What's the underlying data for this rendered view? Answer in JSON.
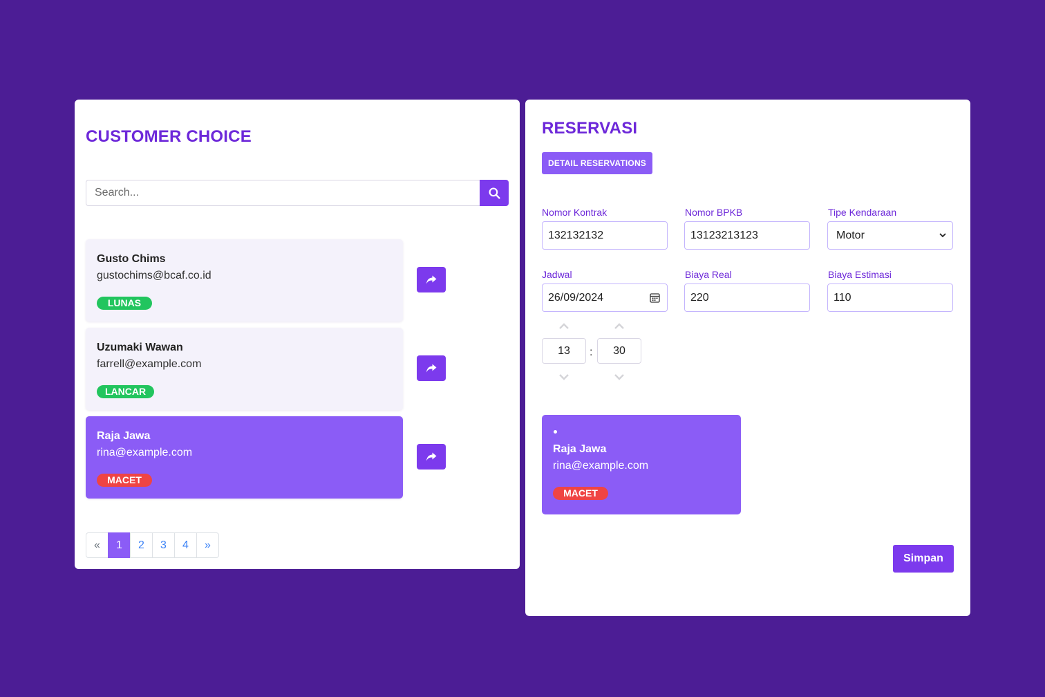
{
  "customer_panel": {
    "title": "CUSTOMER CHOICE",
    "search": {
      "placeholder": "Search...",
      "value": ""
    },
    "customers": [
      {
        "name": "Gusto Chims",
        "email": "gustochims@bcaf.co.id",
        "status": "LUNAS",
        "status_color": "#22c55e",
        "selected": false
      },
      {
        "name": "Uzumaki Wawan",
        "email": "farrell@example.com",
        "status": "LANCAR",
        "status_color": "#22c55e",
        "selected": false
      },
      {
        "name": "Raja Jawa",
        "email": "rina@example.com",
        "status": "MACET",
        "status_color": "#ef4444",
        "selected": true
      }
    ],
    "pagination": {
      "prev": "«",
      "pages": [
        "1",
        "2",
        "3",
        "4"
      ],
      "next": "»",
      "active": "1"
    }
  },
  "reservation_panel": {
    "title": "RESERVASI",
    "detail_button": "DETAIL RESERVATIONS",
    "fields": {
      "nomor_kontrak": {
        "label": "Nomor Kontrak",
        "value": "132132132"
      },
      "nomor_bpkb": {
        "label": "Nomor BPKB",
        "value": "13123213123"
      },
      "tipe_kendaraan": {
        "label": "Tipe Kendaraan",
        "value": "Motor"
      },
      "jadwal": {
        "label": "Jadwal",
        "value": "26/09/2024"
      },
      "biaya_real": {
        "label": "Biaya Real",
        "value": "220"
      },
      "biaya_estimasi": {
        "label": "Biaya Estimasi",
        "value": "110"
      }
    },
    "time": {
      "hour": "13",
      "minute": "30",
      "separator": ":"
    },
    "selected_customer": {
      "name": "Raja Jawa",
      "email": "rina@example.com",
      "status": "MACET",
      "status_color": "#ef4444"
    },
    "save_button": "Simpan"
  },
  "colors": {
    "background": "#4c1d95",
    "accent": "#7c3aed",
    "accent_light": "#8b5cf6",
    "title": "#6d28d9"
  }
}
